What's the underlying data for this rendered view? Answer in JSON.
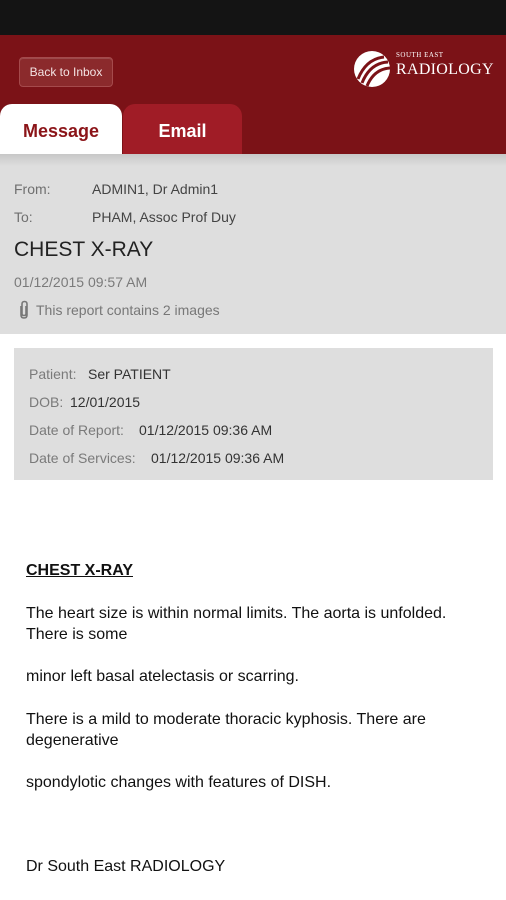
{
  "header": {
    "back_label": "Back to Inbox",
    "logo_small": "SOUTH EAST",
    "logo_big": "RADIOLOGY"
  },
  "tabs": [
    {
      "label": "Message"
    },
    {
      "label": "Email"
    }
  ],
  "message": {
    "from_label": "From:",
    "from_value": "ADMIN1, Dr Admin1",
    "to_label": "To:",
    "to_value": "PHAM, Assoc Prof Duy",
    "subject": "CHEST X-RAY",
    "date": "01/12/2015 09:57 AM",
    "attachment_note": "This report contains 2 images"
  },
  "patient": {
    "patient_label": "Patient:",
    "patient_value": "Ser PATIENT",
    "dob_label": "DOB:",
    "dob_value": "12/01/2015",
    "report_label": "Date of Report:",
    "report_value": "01/12/2015 09:36 AM",
    "services_label": "Date of Services:",
    "services_value": "01/12/2015 09:36 AM"
  },
  "report": {
    "title": "CHEST X-RAY",
    "p1": "The heart size is within normal limits. The aorta is unfolded. There is some",
    "p2": "minor left basal atelectasis or scarring.",
    "p3": "There is a mild to moderate thoracic kyphosis. There are degenerative",
    "p4": "spondylotic changes with features of DISH.",
    "signature": "Dr South East RADIOLOGY"
  }
}
